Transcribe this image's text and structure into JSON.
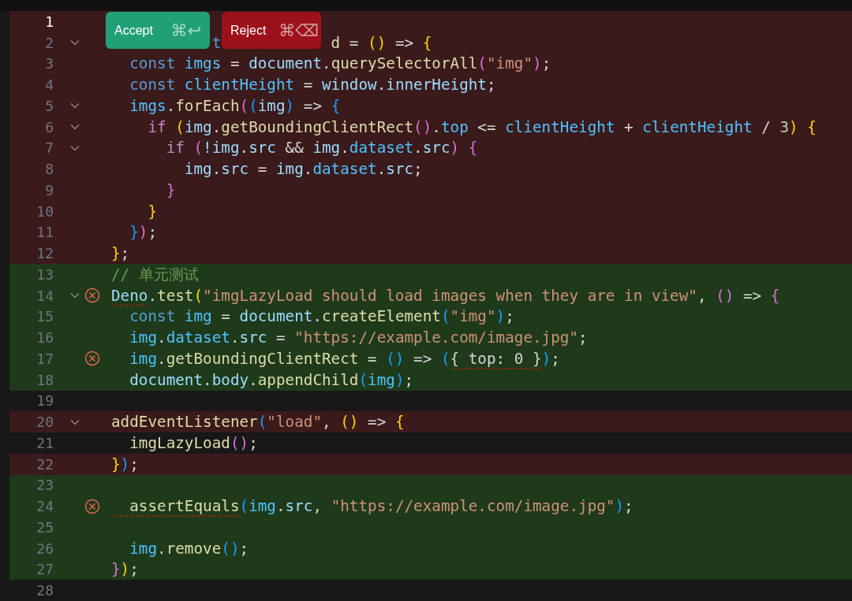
{
  "diff_actions": [
    {
      "kind": "accept",
      "label": "Accept",
      "shortcut": "⌘↩"
    },
    {
      "kind": "reject",
      "label": "Reject",
      "shortcut": "⌘⌫"
    }
  ],
  "lines": [
    {
      "number": "1",
      "kind": "removed",
      "active": true,
      "fold": false,
      "error": false
    },
    {
      "number": "2",
      "kind": "removed",
      "active": false,
      "fold": true,
      "error": false,
      "tokens": [
        {
          "text": "           t",
          "kind": "kw"
        },
        {
          "text": "            d",
          "kind": "fn"
        },
        {
          "text": " = ",
          "kind": "punc"
        },
        {
          "text": "()",
          "kind": "y"
        },
        {
          "text": " => ",
          "kind": "punc"
        },
        {
          "text": "{",
          "kind": "y"
        }
      ]
    },
    {
      "number": "3",
      "kind": "removed",
      "active": false,
      "fold": false,
      "error": false,
      "tokens": [
        {
          "text": "  const",
          "kind": "kw"
        },
        {
          "text": " imgs",
          "kind": "const"
        },
        {
          "text": " = ",
          "kind": "punc"
        },
        {
          "text": "document",
          "kind": "var"
        },
        {
          "text": ".",
          "kind": "punc"
        },
        {
          "text": "querySelectorAll",
          "kind": "fn"
        },
        {
          "text": "(",
          "kind": "p"
        },
        {
          "text": "\"img\"",
          "kind": "str"
        },
        {
          "text": ")",
          "kind": "p"
        },
        {
          "text": ";",
          "kind": "punc"
        }
      ]
    },
    {
      "number": "4",
      "kind": "removed",
      "active": false,
      "fold": false,
      "error": false,
      "tokens": [
        {
          "text": "  const",
          "kind": "kw"
        },
        {
          "text": " clientHeight",
          "kind": "const"
        },
        {
          "text": " = ",
          "kind": "punc"
        },
        {
          "text": "window",
          "kind": "var"
        },
        {
          "text": ".",
          "kind": "punc"
        },
        {
          "text": "innerHeight",
          "kind": "var"
        },
        {
          "text": ";",
          "kind": "punc"
        }
      ]
    },
    {
      "number": "5",
      "kind": "removed",
      "active": false,
      "fold": true,
      "error": false,
      "tokens": [
        {
          "text": "  imgs",
          "kind": "const"
        },
        {
          "text": ".",
          "kind": "punc"
        },
        {
          "text": "forEach",
          "kind": "fn"
        },
        {
          "text": "(",
          "kind": "p"
        },
        {
          "text": "(",
          "kind": "b"
        },
        {
          "text": "img",
          "kind": "var"
        },
        {
          "text": ")",
          "kind": "b"
        },
        {
          "text": " => ",
          "kind": "punc"
        },
        {
          "text": "{",
          "kind": "b"
        }
      ]
    },
    {
      "number": "6",
      "kind": "removed",
      "active": false,
      "fold": true,
      "error": false,
      "tokens": [
        {
          "text": "    if ",
          "kind": "ctl"
        },
        {
          "text": "(",
          "kind": "y"
        },
        {
          "text": "img",
          "kind": "var"
        },
        {
          "text": ".",
          "kind": "punc"
        },
        {
          "text": "getBoundingClientRect",
          "kind": "fn"
        },
        {
          "text": "()",
          "kind": "p"
        },
        {
          "text": ".",
          "kind": "punc"
        },
        {
          "text": "top",
          "kind": "const"
        },
        {
          "text": " <= ",
          "kind": "punc"
        },
        {
          "text": "clientHeight",
          "kind": "const"
        },
        {
          "text": " + ",
          "kind": "punc"
        },
        {
          "text": "clientHeight",
          "kind": "const"
        },
        {
          "text": " / ",
          "kind": "punc"
        },
        {
          "text": "3",
          "kind": "num"
        },
        {
          "text": ")",
          "kind": "y"
        },
        {
          "text": " {",
          "kind": "y"
        }
      ]
    },
    {
      "number": "7",
      "kind": "removed",
      "active": false,
      "fold": true,
      "error": false,
      "tokens": [
        {
          "text": "      if ",
          "kind": "ctl"
        },
        {
          "text": "(",
          "kind": "p"
        },
        {
          "text": "!img",
          "kind": "var"
        },
        {
          "text": ".",
          "kind": "punc"
        },
        {
          "text": "src",
          "kind": "var"
        },
        {
          "text": " && ",
          "kind": "punc"
        },
        {
          "text": "img",
          "kind": "var"
        },
        {
          "text": ".",
          "kind": "punc"
        },
        {
          "text": "dataset",
          "kind": "const"
        },
        {
          "text": ".",
          "kind": "punc"
        },
        {
          "text": "src",
          "kind": "var"
        },
        {
          "text": ")",
          "kind": "p"
        },
        {
          "text": " {",
          "kind": "p"
        }
      ]
    },
    {
      "number": "8",
      "kind": "removed",
      "active": false,
      "fold": false,
      "error": false,
      "tokens": [
        {
          "text": "        img",
          "kind": "var"
        },
        {
          "text": ".",
          "kind": "punc"
        },
        {
          "text": "src",
          "kind": "var"
        },
        {
          "text": " = ",
          "kind": "punc"
        },
        {
          "text": "img",
          "kind": "var"
        },
        {
          "text": ".",
          "kind": "punc"
        },
        {
          "text": "dataset",
          "kind": "const"
        },
        {
          "text": ".",
          "kind": "punc"
        },
        {
          "text": "src",
          "kind": "var"
        },
        {
          "text": ";",
          "kind": "punc"
        }
      ]
    },
    {
      "number": "9",
      "kind": "removed",
      "active": false,
      "fold": false,
      "error": false,
      "tokens": [
        {
          "text": "      }",
          "kind": "p"
        }
      ]
    },
    {
      "number": "10",
      "kind": "removed",
      "active": false,
      "fold": false,
      "error": false,
      "tokens": [
        {
          "text": "    }",
          "kind": "y"
        }
      ]
    },
    {
      "number": "11",
      "kind": "removed",
      "active": false,
      "fold": false,
      "error": false,
      "tokens": [
        {
          "text": "  }",
          "kind": "b"
        },
        {
          "text": ")",
          "kind": "p"
        },
        {
          "text": ";",
          "kind": "punc"
        }
      ]
    },
    {
      "number": "12",
      "kind": "removed",
      "active": false,
      "fold": false,
      "error": false,
      "tokens": [
        {
          "text": "}",
          "kind": "y"
        },
        {
          "text": ";",
          "kind": "punc"
        }
      ]
    },
    {
      "number": "13",
      "kind": "added",
      "active": false,
      "fold": false,
      "error": false,
      "tokens": [
        {
          "text": "// 单元测试",
          "kind": "cmt"
        }
      ]
    },
    {
      "number": "14",
      "kind": "added",
      "active": false,
      "fold": true,
      "error": true,
      "tokens": [
        {
          "text": "Deno",
          "kind": "var",
          "squiggle": true
        },
        {
          "text": ".",
          "kind": "punc"
        },
        {
          "text": "test",
          "kind": "fn"
        },
        {
          "text": "(",
          "kind": "y"
        },
        {
          "text": "\"imgLazyLoad should load images when they are in view\"",
          "kind": "str"
        },
        {
          "text": ", ",
          "kind": "punc"
        },
        {
          "text": "()",
          "kind": "p"
        },
        {
          "text": " => ",
          "kind": "punc"
        },
        {
          "text": "{",
          "kind": "p"
        }
      ]
    },
    {
      "number": "15",
      "kind": "added",
      "active": false,
      "fold": false,
      "error": false,
      "tokens": [
        {
          "text": "  const",
          "kind": "kw"
        },
        {
          "text": " img",
          "kind": "const"
        },
        {
          "text": " = ",
          "kind": "punc"
        },
        {
          "text": "document",
          "kind": "var"
        },
        {
          "text": ".",
          "kind": "punc"
        },
        {
          "text": "createElement",
          "kind": "fn"
        },
        {
          "text": "(",
          "kind": "b"
        },
        {
          "text": "\"img\"",
          "kind": "str"
        },
        {
          "text": ")",
          "kind": "b"
        },
        {
          "text": ";",
          "kind": "punc"
        }
      ]
    },
    {
      "number": "16",
      "kind": "added",
      "active": false,
      "fold": false,
      "error": false,
      "tokens": [
        {
          "text": "  img",
          "kind": "const"
        },
        {
          "text": ".",
          "kind": "punc"
        },
        {
          "text": "dataset",
          "kind": "const"
        },
        {
          "text": ".",
          "kind": "punc"
        },
        {
          "text": "src",
          "kind": "var"
        },
        {
          "text": " = ",
          "kind": "punc"
        },
        {
          "text": "\"https://example.com/image.jpg\"",
          "kind": "str"
        },
        {
          "text": ";",
          "kind": "punc"
        }
      ]
    },
    {
      "number": "17",
      "kind": "added",
      "active": false,
      "fold": false,
      "error": true,
      "tokens": [
        {
          "text": "  img",
          "kind": "const"
        },
        {
          "text": ".",
          "kind": "punc"
        },
        {
          "text": "getBoundingClientRect",
          "kind": "fn"
        },
        {
          "text": " = ",
          "kind": "punc"
        },
        {
          "text": "()",
          "kind": "b"
        },
        {
          "text": " => ",
          "kind": "punc"
        },
        {
          "text": "(",
          "kind": "b"
        },
        {
          "text": "{ top: 0 }",
          "kind": "obj",
          "squiggle": true
        },
        {
          "text": ")",
          "kind": "b"
        },
        {
          "text": ";",
          "kind": "punc"
        }
      ]
    },
    {
      "number": "18",
      "kind": "added",
      "active": false,
      "fold": false,
      "error": false,
      "tokens": [
        {
          "text": "  document",
          "kind": "var"
        },
        {
          "text": ".",
          "kind": "punc"
        },
        {
          "text": "body",
          "kind": "var"
        },
        {
          "text": ".",
          "kind": "punc"
        },
        {
          "text": "appendChild",
          "kind": "fn"
        },
        {
          "text": "(",
          "kind": "b"
        },
        {
          "text": "img",
          "kind": "const"
        },
        {
          "text": ")",
          "kind": "b"
        },
        {
          "text": ";",
          "kind": "punc"
        }
      ]
    },
    {
      "number": "19",
      "kind": "plain",
      "active": false,
      "fold": false,
      "error": false
    },
    {
      "number": "20",
      "kind": "removed",
      "active": false,
      "fold": true,
      "error": false,
      "tokens": [
        {
          "text": "addEventListener",
          "kind": "fn"
        },
        {
          "text": "(",
          "kind": "b"
        },
        {
          "text": "\"load\"",
          "kind": "str"
        },
        {
          "text": ", ",
          "kind": "punc"
        },
        {
          "text": "()",
          "kind": "y"
        },
        {
          "text": " => ",
          "kind": "punc"
        },
        {
          "text": "{",
          "kind": "y"
        }
      ]
    },
    {
      "number": "21",
      "kind": "plain",
      "active": false,
      "fold": false,
      "error": false,
      "tokens": [
        {
          "text": "  imgLazyLoad",
          "kind": "fn"
        },
        {
          "text": "()",
          "kind": "p"
        },
        {
          "text": ";",
          "kind": "punc"
        }
      ]
    },
    {
      "number": "22",
      "kind": "removed",
      "active": false,
      "fold": false,
      "error": false,
      "tokens": [
        {
          "text": "}",
          "kind": "y"
        },
        {
          "text": ")",
          "kind": "b"
        },
        {
          "text": ";",
          "kind": "punc"
        }
      ]
    },
    {
      "number": "23",
      "kind": "added",
      "active": false,
      "fold": false,
      "error": false
    },
    {
      "number": "24",
      "kind": "added",
      "active": false,
      "fold": false,
      "error": true,
      "tokens": [
        {
          "text": "  assertEquals",
          "kind": "fn",
          "squiggle": true
        },
        {
          "text": "(",
          "kind": "b"
        },
        {
          "text": "img",
          "kind": "const"
        },
        {
          "text": ".",
          "kind": "punc"
        },
        {
          "text": "src",
          "kind": "var"
        },
        {
          "text": ", ",
          "kind": "punc"
        },
        {
          "text": "\"https://example.com/image.jpg\"",
          "kind": "str"
        },
        {
          "text": ")",
          "kind": "b"
        },
        {
          "text": ";",
          "kind": "punc"
        }
      ]
    },
    {
      "number": "25",
      "kind": "added",
      "active": false,
      "fold": false,
      "error": false
    },
    {
      "number": "26",
      "kind": "added",
      "active": false,
      "fold": false,
      "error": false,
      "tokens": [
        {
          "text": "  img",
          "kind": "const"
        },
        {
          "text": ".",
          "kind": "punc"
        },
        {
          "text": "remove",
          "kind": "fn"
        },
        {
          "text": "()",
          "kind": "b"
        },
        {
          "text": ";",
          "kind": "punc"
        }
      ]
    },
    {
      "number": "27",
      "kind": "added",
      "active": false,
      "fold": false,
      "error": false,
      "tokens": [
        {
          "text": "}",
          "kind": "p"
        },
        {
          "text": ")",
          "kind": "y"
        },
        {
          "text": ";",
          "kind": "punc"
        }
      ]
    },
    {
      "number": "28",
      "kind": "plain",
      "active": false,
      "fold": false,
      "error": false
    }
  ]
}
